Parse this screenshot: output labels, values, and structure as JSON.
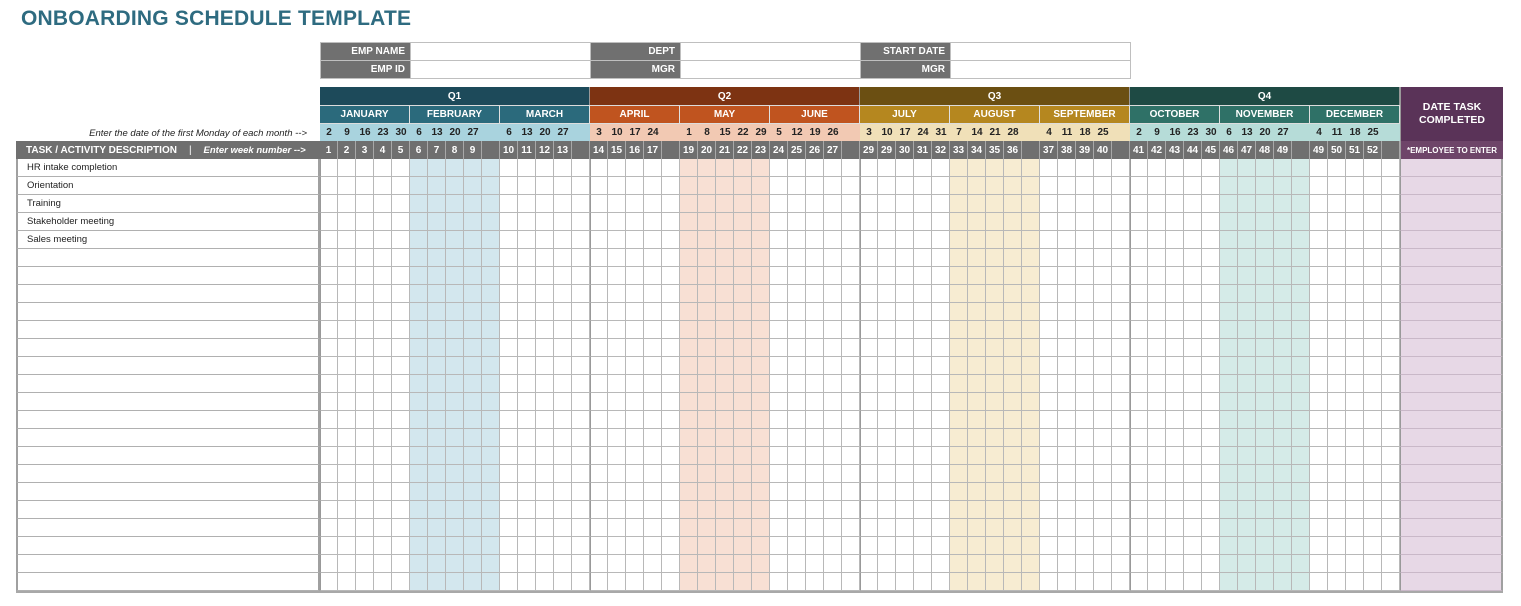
{
  "title": "ONBOARDING SCHEDULE TEMPLATE",
  "info_fields": [
    [
      {
        "label": "EMP NAME",
        "value": ""
      },
      {
        "label": "DEPT",
        "value": ""
      },
      {
        "label": "START DATE",
        "value": ""
      }
    ],
    [
      {
        "label": "EMP ID",
        "value": ""
      },
      {
        "label": "MGR",
        "value": ""
      },
      {
        "label": "MGR",
        "value": ""
      }
    ]
  ],
  "first_monday_hint": "Enter the date of the first Monday of each month -->",
  "task_header": "TASK / ACTIVITY DESCRIPTION",
  "week_hint": "Enter week number -->",
  "date_completed_header": "DATE TASK COMPLETED",
  "employee_to_enter": "*EMPLOYEE TO ENTER",
  "colors": {
    "q1_dark": "#1d4a5a",
    "q1_month": "#2b6a7c",
    "q1_light": "#a9d3de",
    "q1_shade": "#d3e7ee",
    "q2_dark": "#7d3312",
    "q2_month": "#c0541f",
    "q2_light": "#f2c9b3",
    "q2_shade": "#f8e0d4",
    "q3_dark": "#6b4f12",
    "q3_month": "#b5871f",
    "q3_light": "#f0e0b8",
    "q3_shade": "#f7ecd2",
    "q4_dark": "#1e4a44",
    "q4_month": "#2f7167",
    "q4_light": "#b6dcd8",
    "q4_shade": "#d5ebe8",
    "week_bg": "#6f6f6f",
    "completed_dark": "#5a3358",
    "completed_sub": "#6e4569",
    "completed_body": "#e7d8e6"
  },
  "quarters": [
    {
      "label": "Q1",
      "key": "q1",
      "months": [
        {
          "name": "JANUARY",
          "dates": [
            "2",
            "9",
            "16",
            "23",
            "30"
          ],
          "weeks": [
            "1",
            "2",
            "3",
            "4",
            "5"
          ]
        },
        {
          "name": "FEBRUARY",
          "dates": [
            "6",
            "13",
            "20",
            "27",
            ""
          ],
          "weeks": [
            "6",
            "7",
            "8",
            "9",
            ""
          ]
        },
        {
          "name": "MARCH",
          "dates": [
            "6",
            "13",
            "20",
            "27",
            ""
          ],
          "weeks": [
            "10",
            "11",
            "12",
            "13",
            ""
          ]
        }
      ]
    },
    {
      "label": "Q2",
      "key": "q2",
      "months": [
        {
          "name": "APRIL",
          "dates": [
            "3",
            "10",
            "17",
            "24",
            ""
          ],
          "weeks": [
            "14",
            "15",
            "16",
            "17",
            ""
          ]
        },
        {
          "name": "MAY",
          "dates": [
            "1",
            "8",
            "15",
            "22",
            "29"
          ],
          "weeks": [
            "19",
            "20",
            "21",
            "22",
            "23"
          ]
        },
        {
          "name": "JUNE",
          "dates": [
            "5",
            "12",
            "19",
            "26",
            ""
          ],
          "weeks": [
            "24",
            "25",
            "26",
            "27",
            ""
          ]
        }
      ]
    },
    {
      "label": "Q3",
      "key": "q3",
      "months": [
        {
          "name": "JULY",
          "dates": [
            "3",
            "10",
            "17",
            "24",
            "31"
          ],
          "weeks": [
            "29",
            "29",
            "30",
            "31",
            "32"
          ]
        },
        {
          "name": "AUGUST",
          "dates": [
            "7",
            "14",
            "21",
            "28",
            ""
          ],
          "weeks": [
            "33",
            "34",
            "35",
            "36",
            ""
          ]
        },
        {
          "name": "SEPTEMBER",
          "dates": [
            "4",
            "11",
            "18",
            "25",
            ""
          ],
          "weeks": [
            "37",
            "38",
            "39",
            "40",
            ""
          ]
        }
      ]
    },
    {
      "label": "Q4",
      "key": "q4",
      "months": [
        {
          "name": "OCTOBER",
          "dates": [
            "2",
            "9",
            "16",
            "23",
            "30"
          ],
          "weeks": [
            "41",
            "42",
            "43",
            "44",
            "45"
          ]
        },
        {
          "name": "NOVEMBER",
          "dates": [
            "6",
            "13",
            "20",
            "27",
            ""
          ],
          "weeks": [
            "46",
            "47",
            "48",
            "49",
            ""
          ]
        },
        {
          "name": "DECEMBER",
          "dates": [
            "4",
            "11",
            "18",
            "25",
            ""
          ],
          "weeks": [
            "49",
            "50",
            "51",
            "52",
            ""
          ]
        }
      ]
    }
  ],
  "tasks": [
    "HR intake completion",
    "Orientation",
    "Training",
    "Stakeholder meeting",
    "Sales meeting",
    "",
    "",
    "",
    "",
    "",
    "",
    "",
    "",
    "",
    "",
    "",
    "",
    "",
    "",
    "",
    "",
    "",
    "",
    ""
  ]
}
